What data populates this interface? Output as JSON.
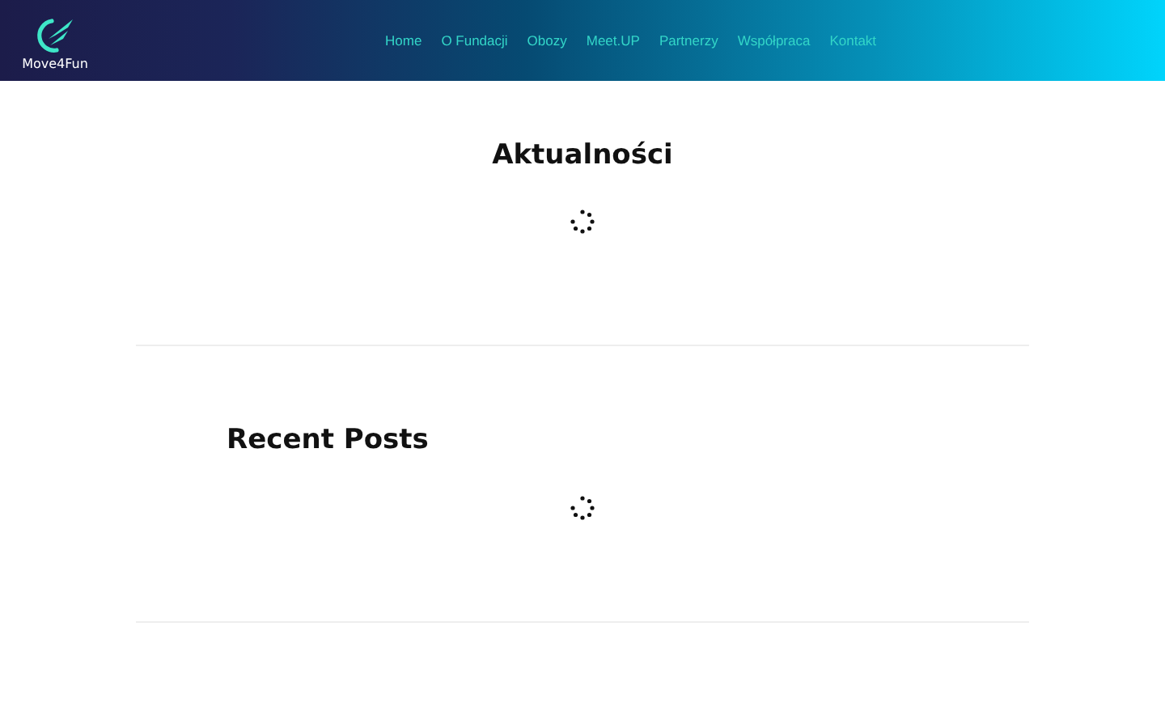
{
  "header": {
    "logo_text": "Move4Fun",
    "nav": [
      "Home",
      "O Fundacji",
      "Obozy",
      "Meet.UP",
      "Partnerzy",
      "Współpraca",
      "Kontakt"
    ]
  },
  "sections": [
    {
      "title": "Aktualności",
      "kind": "centered",
      "loading": true
    },
    {
      "title": "Recent Posts",
      "kind": "indented",
      "loading": true
    }
  ]
}
